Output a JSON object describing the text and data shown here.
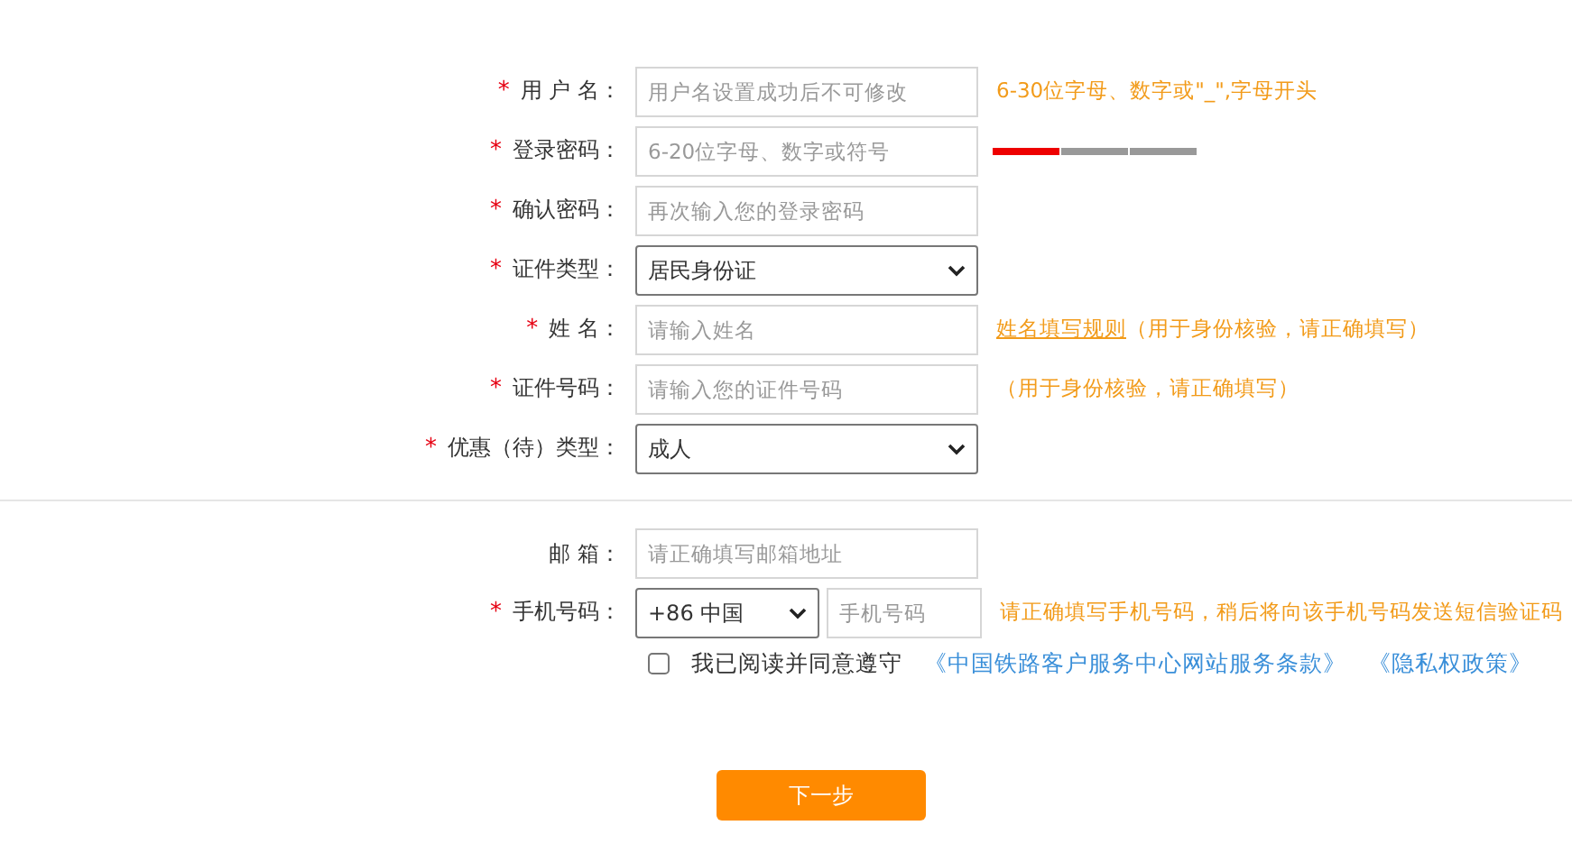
{
  "sections": [
    {
      "fields": [
        {
          "kind": "input",
          "mark": "*",
          "label": "用 户 名：",
          "placeholder": "用户名设置成功后不可修改",
          "hint": "6-30位字母、数字或\"_\",字母开头"
        },
        {
          "kind": "password",
          "mark": "*",
          "label": "登录密码：",
          "placeholder": "6-20位字母、数字或符号"
        },
        {
          "kind": "input",
          "mark": "*",
          "label": "确认密码：",
          "placeholder": "再次输入您的登录密码"
        },
        {
          "kind": "select",
          "mark": "*",
          "label": "证件类型：",
          "value": "居民身份证"
        },
        {
          "kind": "input",
          "mark": "*",
          "label": "姓 名：",
          "placeholder": "请输入姓名",
          "hint_link": "姓名填写规则",
          "hint": "（用于身份核验，请正确填写）"
        },
        {
          "kind": "input",
          "mark": "*",
          "label": "证件号码：",
          "placeholder": "请输入您的证件号码",
          "hint": "（用于身份核验，请正确填写）"
        },
        {
          "kind": "select",
          "mark": "*",
          "label": "优惠（待）类型：",
          "value": "成人"
        }
      ]
    },
    {
      "fields": [
        {
          "kind": "input",
          "label": "邮 箱：",
          "placeholder": "请正确填写邮箱地址"
        },
        {
          "kind": "phone",
          "mark": "*",
          "label": "手机号码：",
          "value": "+86 中国",
          "placeholder": "手机号码",
          "hint": "请正确填写手机号码，稍后将向该手机号码发送短信验证码"
        }
      ]
    }
  ],
  "agreement": {
    "checked": false,
    "text": "我已阅读并同意遵守",
    "links": [
      "《中国铁路客户服务中心网站服务条款》",
      "《隐私权政策》"
    ]
  },
  "next_button": "下一步"
}
